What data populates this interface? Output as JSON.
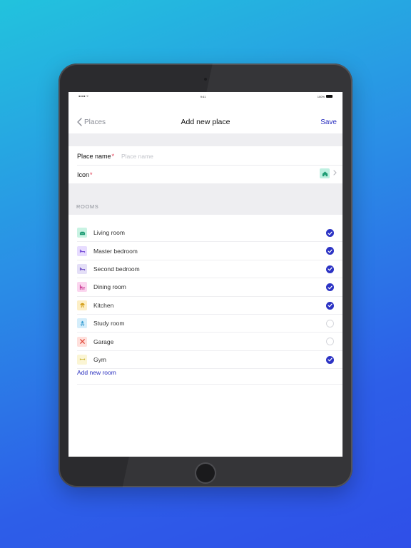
{
  "status": {
    "left": "●●●● ᯤ",
    "time": "9:41",
    "battery": "100%"
  },
  "nav": {
    "back_label": "Places",
    "title": "Add new place",
    "save_label": "Save"
  },
  "form": {
    "place_name_label": "Place name",
    "required_mark": "*",
    "place_name_placeholder": "Place name",
    "place_name_value": "",
    "icon_label": "Icon",
    "icon_selected": "home-icon",
    "icon_color": "#bff0e1"
  },
  "rooms_header": "ROOMS",
  "rooms": [
    {
      "label": "Living room",
      "icon": "sofa-icon",
      "bg": "#c9f3e3",
      "fg": "#1f9c74",
      "checked": true
    },
    {
      "label": "Master bedroom",
      "icon": "bed-icon",
      "bg": "#e7dcff",
      "fg": "#7d55d9",
      "checked": true
    },
    {
      "label": "Second bedroom",
      "icon": "bed-icon",
      "bg": "#e4dff7",
      "fg": "#7a5cc9",
      "checked": true
    },
    {
      "label": "Dining room",
      "icon": "dining-icon",
      "bg": "#fbd6ef",
      "fg": "#c7308f",
      "checked": true
    },
    {
      "label": "Kitchen",
      "icon": "kitchen-icon",
      "bg": "#fdefc6",
      "fg": "#d09a10",
      "checked": true
    },
    {
      "label": "Study room",
      "icon": "study-icon",
      "bg": "#d5eefb",
      "fg": "#3a9fd3",
      "checked": false
    },
    {
      "label": "Garage",
      "icon": "tools-icon",
      "bg": "#ffe0dc",
      "fg": "#e0483a",
      "checked": false
    },
    {
      "label": "Gym",
      "icon": "dumbbell-icon",
      "bg": "#fbf5d4",
      "fg": "#c8b12a",
      "checked": true
    }
  ],
  "add_room_label": "Add new room",
  "colors": {
    "accent": "#2c33c4",
    "required": "#e0334a"
  }
}
